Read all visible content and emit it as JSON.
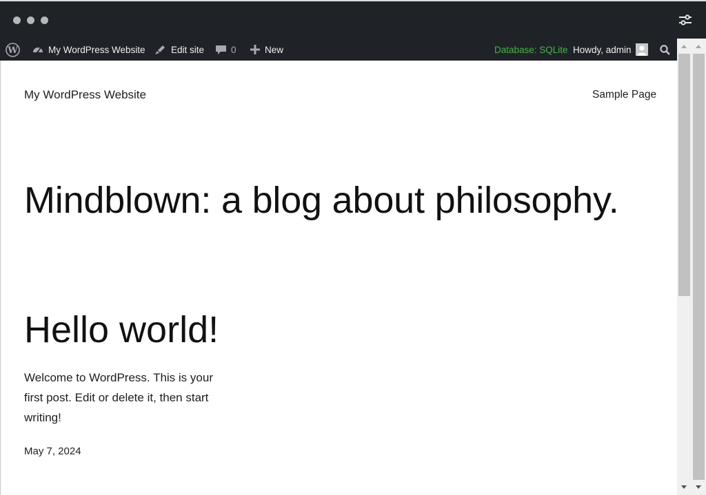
{
  "window": {
    "controls": [
      "dot",
      "dot",
      "dot"
    ]
  },
  "adminbar": {
    "site_name": "My WordPress Website",
    "edit_site": "Edit site",
    "comments_count": "0",
    "new_label": "New",
    "database": "Database: SQLite",
    "greeting": "Howdy, admin"
  },
  "site": {
    "title": "My WordPress Website",
    "nav": [
      "Sample Page"
    ],
    "tagline": "Mindblown: a blog about philosophy."
  },
  "post": {
    "title": "Hello world!",
    "excerpt": "Welcome to WordPress. This is your first post. Edit or delete it, then start writing!",
    "date": "May 7, 2024"
  },
  "colors": {
    "bar_background": "#1f2327",
    "database_accent": "#49b24c",
    "page_background": "#ffffff"
  }
}
